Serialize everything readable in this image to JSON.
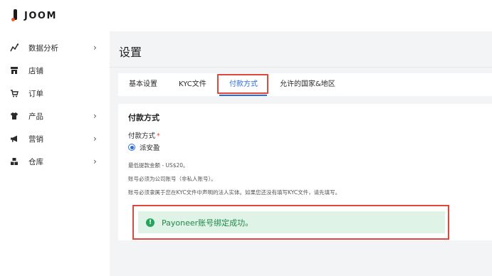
{
  "brand": {
    "name": "JOOM"
  },
  "sidebar": {
    "items": [
      {
        "label": "数据分析",
        "icon": "analytics-icon",
        "has_chevron": true
      },
      {
        "label": "店铺",
        "icon": "store-icon",
        "has_chevron": false
      },
      {
        "label": "订单",
        "icon": "cart-icon",
        "has_chevron": false
      },
      {
        "label": "产品",
        "icon": "tshirt-icon",
        "has_chevron": true
      },
      {
        "label": "营销",
        "icon": "megaphone-icon",
        "has_chevron": true
      },
      {
        "label": "仓库",
        "icon": "warehouse-icon",
        "has_chevron": true
      }
    ]
  },
  "page": {
    "title": "设置"
  },
  "tabs": [
    {
      "label": "基本设置",
      "active": false
    },
    {
      "label": "KYC文件",
      "active": false
    },
    {
      "label": "付款方式",
      "active": true
    },
    {
      "label": "允许的国家&地区",
      "active": false
    }
  ],
  "payment": {
    "section_title": "付款方式",
    "field_label": "付款方式",
    "required_mark": "*",
    "selected_option": "派安盈",
    "notes": [
      "最低提款金额 - US$20。",
      "账号必须为公司账号（非私人账号）。",
      "账号必须隶属于您在KYC文件中声明的法人实体。如果您还没有填写KYC文件，请先填写。"
    ]
  },
  "alert": {
    "text": "Payoneer账号绑定成功。",
    "icon": "check-circle-icon",
    "color": "#22a65a"
  },
  "colors": {
    "accent": "#2f6bd8",
    "highlight": "#e0473a",
    "success_bg": "#dff3e6"
  }
}
